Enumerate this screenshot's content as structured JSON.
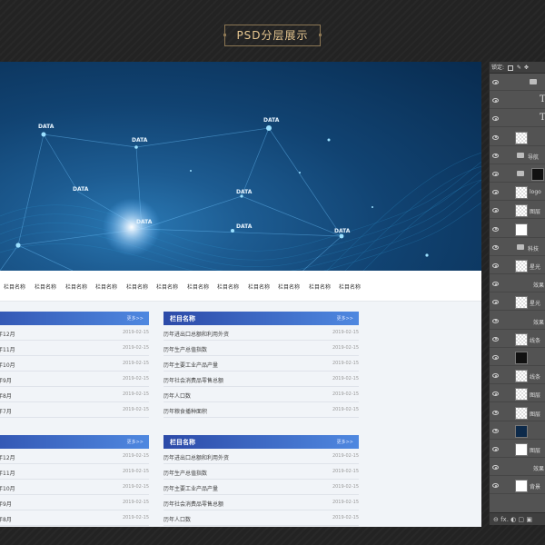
{
  "title_badge": "PSD分层展示",
  "banner": {
    "labels": [
      "DATA",
      "DATA",
      "DATA",
      "DATA",
      "DATA",
      "DATA",
      "DATA",
      "DATA"
    ]
  },
  "nav": {
    "items": [
      "栏目名称",
      "栏目名称",
      "栏目名称",
      "栏目名称",
      "栏目名称",
      "栏目名称",
      "栏目名称",
      "栏目名称",
      "栏目名称",
      "栏目名称",
      "栏目名称",
      "栏目名称"
    ]
  },
  "panels": [
    {
      "title": "",
      "more": "更多>>",
      "rows": [
        {
          "text": "年12月",
          "date": "2019-02-15"
        },
        {
          "text": "年11月",
          "date": "2019-02-15"
        },
        {
          "text": "年10月",
          "date": "2019-02-15"
        },
        {
          "text": "年9月",
          "date": "2019-02-15"
        },
        {
          "text": "年8月",
          "date": "2019-02-15"
        },
        {
          "text": "年7月",
          "date": "2019-02-15"
        }
      ]
    },
    {
      "title": "栏目名称",
      "more": "更多>>",
      "rows": [
        {
          "text": "历年进出口总额和利用外资",
          "date": "2019-02-15"
        },
        {
          "text": "历年生产总值指数",
          "date": "2019-02-15"
        },
        {
          "text": "历年主要工业产品产量",
          "date": "2019-02-15"
        },
        {
          "text": "历年社会消费品零售总额",
          "date": "2019-02-15"
        },
        {
          "text": "历年人口数",
          "date": "2019-02-15"
        },
        {
          "text": "历年粮食播种面积",
          "date": "2019-02-15"
        }
      ]
    },
    {
      "title": "",
      "more": "更多>>",
      "rows": [
        {
          "text": "年12月",
          "date": "2019-02-15"
        },
        {
          "text": "年11月",
          "date": "2019-02-15"
        },
        {
          "text": "年10月",
          "date": "2019-02-15"
        },
        {
          "text": "年9月",
          "date": "2019-02-15"
        },
        {
          "text": "年8月",
          "date": "2019-02-15"
        }
      ]
    },
    {
      "title": "栏目名称",
      "more": "更多>>",
      "rows": [
        {
          "text": "历年进出口总额和利用外资",
          "date": "2019-02-15"
        },
        {
          "text": "历年生产总值指数",
          "date": "2019-02-15"
        },
        {
          "text": "历年主要工业产品产量",
          "date": "2019-02-15"
        },
        {
          "text": "历年社会消费品零售总额",
          "date": "2019-02-15"
        },
        {
          "text": "历年人口数",
          "date": "2019-02-15"
        }
      ]
    }
  ],
  "layers_panel": {
    "lock_label": "锁定:",
    "layers": [
      {
        "name": "",
        "kind": "folder-open"
      },
      {
        "name": "",
        "kind": "text"
      },
      {
        "name": "",
        "kind": "text"
      },
      {
        "name": "",
        "kind": "pixel"
      },
      {
        "name": "导航",
        "kind": "folder"
      },
      {
        "name": "",
        "kind": "folder-black"
      },
      {
        "name": "logo",
        "kind": "pixel"
      },
      {
        "name": "图层",
        "kind": "pixel"
      },
      {
        "name": "",
        "kind": "white"
      },
      {
        "name": "科技",
        "kind": "folder"
      },
      {
        "name": "星光",
        "kind": "pixel"
      },
      {
        "name": "效果",
        "kind": "effect"
      },
      {
        "name": "星光",
        "kind": "pixel"
      },
      {
        "name": "效果",
        "kind": "effect"
      },
      {
        "name": "线条",
        "kind": "pixel"
      },
      {
        "name": "",
        "kind": "black"
      },
      {
        "name": "线条",
        "kind": "pixel"
      },
      {
        "name": "图层",
        "kind": "pixel"
      },
      {
        "name": "图层",
        "kind": "pixel"
      },
      {
        "name": "",
        "kind": "dark"
      },
      {
        "name": "图层",
        "kind": "white"
      },
      {
        "name": "效果",
        "kind": "effect"
      },
      {
        "name": "背景",
        "kind": "white"
      }
    ],
    "footer": "⊖ fx. ◐ ▢ ▣"
  },
  "colors": {
    "badge_gold": "#e8c891",
    "panel_blue_start": "#2c4aa8",
    "panel_blue_end": "#4f88e0",
    "banner_dark": "#082b4f"
  }
}
